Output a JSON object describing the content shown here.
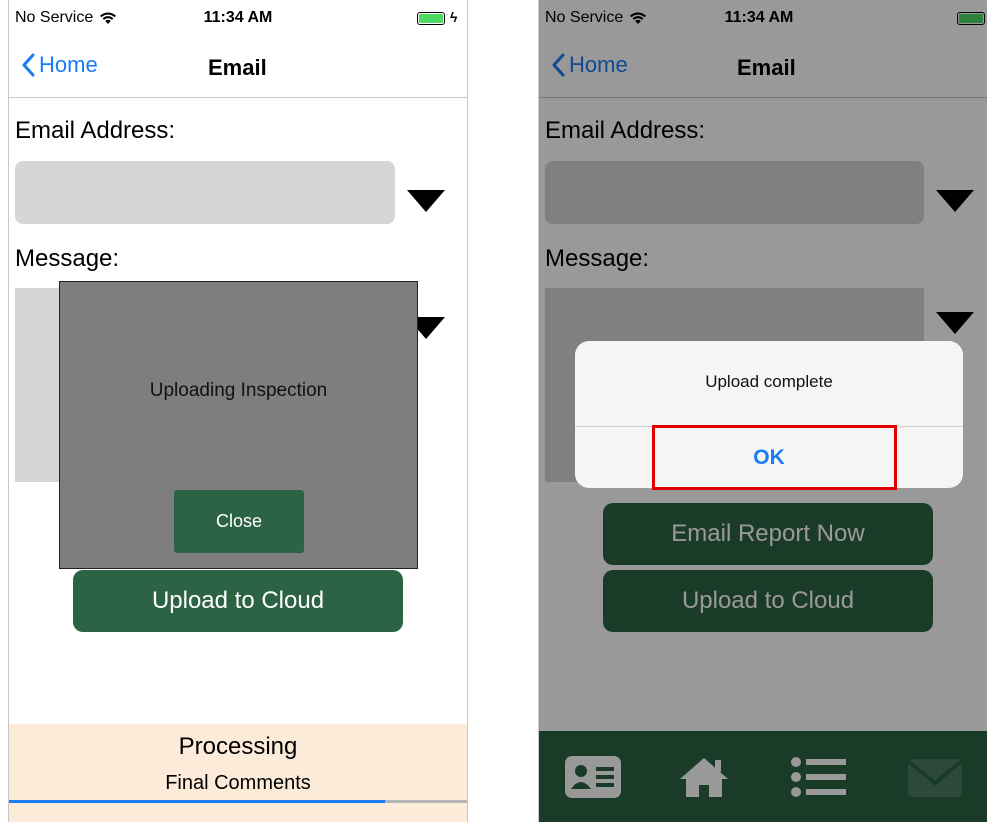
{
  "status_bar": {
    "carrier": "No Service",
    "time": "11:34 AM"
  },
  "nav": {
    "back_label": "Home",
    "title": "Email"
  },
  "form": {
    "email_label": "Email Address:",
    "message_label": "Message:",
    "email_value": "",
    "message_value": ""
  },
  "buttons": {
    "email_report": "Email Report Now",
    "upload_cloud": "Upload to Cloud"
  },
  "upload_popup": {
    "message": "Uploading Inspection",
    "close_label": "Close"
  },
  "processing": {
    "title": "Processing",
    "subtitle": "Final Comments",
    "progress": 0.82
  },
  "alert": {
    "message": "Upload complete",
    "ok_label": "OK"
  },
  "tab_bar": {
    "items": [
      "contact-card-icon",
      "home-icon",
      "list-icon",
      "mail-icon"
    ]
  },
  "colors": {
    "accent_green": "#2c6344",
    "ios_blue": "#1a7cf5",
    "battery_green": "#4cd964",
    "processing_bg": "#fcebd8",
    "highlight_red": "#e00000"
  }
}
